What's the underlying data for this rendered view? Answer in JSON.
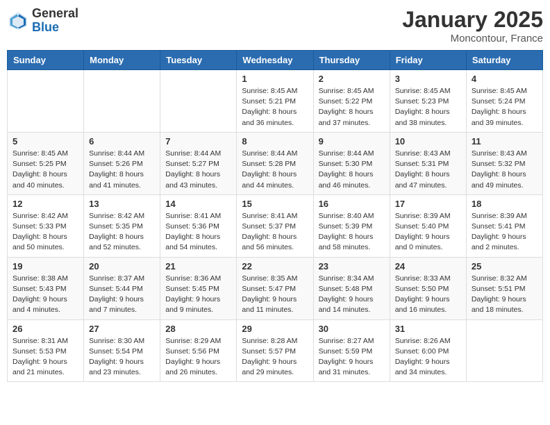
{
  "logo": {
    "general": "General",
    "blue": "Blue"
  },
  "title": "January 2025",
  "location": "Moncontour, France",
  "days_header": [
    "Sunday",
    "Monday",
    "Tuesday",
    "Wednesday",
    "Thursday",
    "Friday",
    "Saturday"
  ],
  "weeks": [
    [
      {
        "day": "",
        "info": ""
      },
      {
        "day": "",
        "info": ""
      },
      {
        "day": "",
        "info": ""
      },
      {
        "day": "1",
        "info": "Sunrise: 8:45 AM\nSunset: 5:21 PM\nDaylight: 8 hours and 36 minutes."
      },
      {
        "day": "2",
        "info": "Sunrise: 8:45 AM\nSunset: 5:22 PM\nDaylight: 8 hours and 37 minutes."
      },
      {
        "day": "3",
        "info": "Sunrise: 8:45 AM\nSunset: 5:23 PM\nDaylight: 8 hours and 38 minutes."
      },
      {
        "day": "4",
        "info": "Sunrise: 8:45 AM\nSunset: 5:24 PM\nDaylight: 8 hours and 39 minutes."
      }
    ],
    [
      {
        "day": "5",
        "info": "Sunrise: 8:45 AM\nSunset: 5:25 PM\nDaylight: 8 hours and 40 minutes."
      },
      {
        "day": "6",
        "info": "Sunrise: 8:44 AM\nSunset: 5:26 PM\nDaylight: 8 hours and 41 minutes."
      },
      {
        "day": "7",
        "info": "Sunrise: 8:44 AM\nSunset: 5:27 PM\nDaylight: 8 hours and 43 minutes."
      },
      {
        "day": "8",
        "info": "Sunrise: 8:44 AM\nSunset: 5:28 PM\nDaylight: 8 hours and 44 minutes."
      },
      {
        "day": "9",
        "info": "Sunrise: 8:44 AM\nSunset: 5:30 PM\nDaylight: 8 hours and 46 minutes."
      },
      {
        "day": "10",
        "info": "Sunrise: 8:43 AM\nSunset: 5:31 PM\nDaylight: 8 hours and 47 minutes."
      },
      {
        "day": "11",
        "info": "Sunrise: 8:43 AM\nSunset: 5:32 PM\nDaylight: 8 hours and 49 minutes."
      }
    ],
    [
      {
        "day": "12",
        "info": "Sunrise: 8:42 AM\nSunset: 5:33 PM\nDaylight: 8 hours and 50 minutes."
      },
      {
        "day": "13",
        "info": "Sunrise: 8:42 AM\nSunset: 5:35 PM\nDaylight: 8 hours and 52 minutes."
      },
      {
        "day": "14",
        "info": "Sunrise: 8:41 AM\nSunset: 5:36 PM\nDaylight: 8 hours and 54 minutes."
      },
      {
        "day": "15",
        "info": "Sunrise: 8:41 AM\nSunset: 5:37 PM\nDaylight: 8 hours and 56 minutes."
      },
      {
        "day": "16",
        "info": "Sunrise: 8:40 AM\nSunset: 5:39 PM\nDaylight: 8 hours and 58 minutes."
      },
      {
        "day": "17",
        "info": "Sunrise: 8:39 AM\nSunset: 5:40 PM\nDaylight: 9 hours and 0 minutes."
      },
      {
        "day": "18",
        "info": "Sunrise: 8:39 AM\nSunset: 5:41 PM\nDaylight: 9 hours and 2 minutes."
      }
    ],
    [
      {
        "day": "19",
        "info": "Sunrise: 8:38 AM\nSunset: 5:43 PM\nDaylight: 9 hours and 4 minutes."
      },
      {
        "day": "20",
        "info": "Sunrise: 8:37 AM\nSunset: 5:44 PM\nDaylight: 9 hours and 7 minutes."
      },
      {
        "day": "21",
        "info": "Sunrise: 8:36 AM\nSunset: 5:45 PM\nDaylight: 9 hours and 9 minutes."
      },
      {
        "day": "22",
        "info": "Sunrise: 8:35 AM\nSunset: 5:47 PM\nDaylight: 9 hours and 11 minutes."
      },
      {
        "day": "23",
        "info": "Sunrise: 8:34 AM\nSunset: 5:48 PM\nDaylight: 9 hours and 14 minutes."
      },
      {
        "day": "24",
        "info": "Sunrise: 8:33 AM\nSunset: 5:50 PM\nDaylight: 9 hours and 16 minutes."
      },
      {
        "day": "25",
        "info": "Sunrise: 8:32 AM\nSunset: 5:51 PM\nDaylight: 9 hours and 18 minutes."
      }
    ],
    [
      {
        "day": "26",
        "info": "Sunrise: 8:31 AM\nSunset: 5:53 PM\nDaylight: 9 hours and 21 minutes."
      },
      {
        "day": "27",
        "info": "Sunrise: 8:30 AM\nSunset: 5:54 PM\nDaylight: 9 hours and 23 minutes."
      },
      {
        "day": "28",
        "info": "Sunrise: 8:29 AM\nSunset: 5:56 PM\nDaylight: 9 hours and 26 minutes."
      },
      {
        "day": "29",
        "info": "Sunrise: 8:28 AM\nSunset: 5:57 PM\nDaylight: 9 hours and 29 minutes."
      },
      {
        "day": "30",
        "info": "Sunrise: 8:27 AM\nSunset: 5:59 PM\nDaylight: 9 hours and 31 minutes."
      },
      {
        "day": "31",
        "info": "Sunrise: 8:26 AM\nSunset: 6:00 PM\nDaylight: 9 hours and 34 minutes."
      },
      {
        "day": "",
        "info": ""
      }
    ]
  ]
}
